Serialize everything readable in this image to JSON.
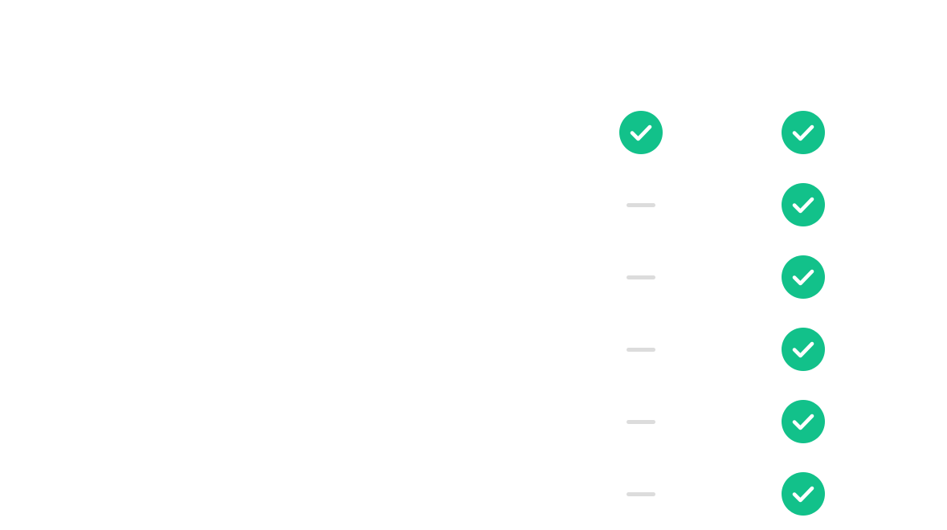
{
  "colors": {
    "check": "#12c18a",
    "dash": "#dcdcdc",
    "background": "#ffffff"
  },
  "rows": [
    {
      "col_a": "check-icon",
      "col_b": "check-icon"
    },
    {
      "col_a": "dash-icon",
      "col_b": "check-icon"
    },
    {
      "col_a": "dash-icon",
      "col_b": "check-icon"
    },
    {
      "col_a": "dash-icon",
      "col_b": "check-icon"
    },
    {
      "col_a": "dash-icon",
      "col_b": "check-icon"
    },
    {
      "col_a": "dash-icon",
      "col_b": "check-icon"
    }
  ]
}
